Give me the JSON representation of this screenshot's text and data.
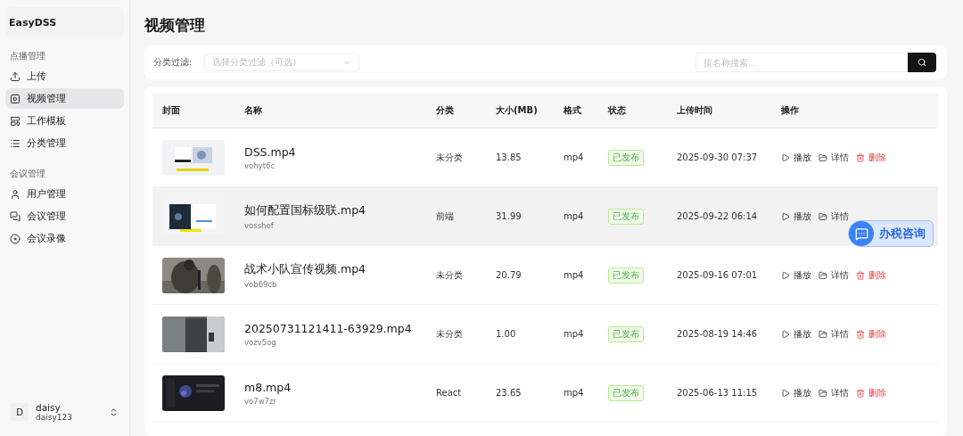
{
  "sidebar": {
    "brand": "EasyDSS",
    "groups": [
      {
        "title": "点播管理",
        "items": [
          {
            "label": "上传",
            "selected": false
          },
          {
            "label": "视频管理",
            "selected": true
          },
          {
            "label": "工作模板",
            "selected": false
          },
          {
            "label": "分类管理",
            "selected": false
          }
        ]
      },
      {
        "title": "会议管理",
        "items": [
          {
            "label": "用户管理",
            "selected": false
          },
          {
            "label": "会议管理",
            "selected": false
          },
          {
            "label": "会议录像",
            "selected": false
          }
        ]
      }
    ],
    "user": {
      "avatar": "D",
      "name": "daisy",
      "account": "daisy123"
    }
  },
  "page_title": "视频管理",
  "filter": {
    "label": "分类过滤:",
    "placeholder": "选择分类过滤（可选)"
  },
  "search": {
    "placeholder": "按名称搜索..."
  },
  "table": {
    "columns": [
      "封面",
      "名称",
      "分类",
      "大小(MB)",
      "格式",
      "状态",
      "上传时间",
      "操作"
    ],
    "rows": [
      {
        "cover": {
          "kind": "picture"
        },
        "name": "DSS.mp4",
        "id": "vohyt6c",
        "category": "未分类",
        "size": "13.85",
        "format": "mp4",
        "status": "已发布",
        "time": "2025-09-30 07:37",
        "hovered": false,
        "actions": [
          {
            "kind": "play",
            "label": "播放"
          },
          {
            "kind": "detail",
            "label": "详情"
          },
          {
            "kind": "delete",
            "label": "删除"
          }
        ]
      },
      {
        "cover": {
          "kind": "picture"
        },
        "name": "如何配置国标级联.mp4",
        "id": "vosshef",
        "category": "前端",
        "size": "31.99",
        "format": "mp4",
        "status": "已发布",
        "time": "2025-09-22 06:14",
        "hovered": true,
        "actions": [
          {
            "kind": "play",
            "label": "播放"
          },
          {
            "kind": "detail",
            "label": "详情"
          }
        ]
      },
      {
        "cover": {
          "kind": "picture"
        },
        "name": "战术小队宣传视频.mp4",
        "id": "vob69cb",
        "category": "未分类",
        "size": "20.79",
        "format": "mp4",
        "status": "已发布",
        "time": "2025-09-16 07:01",
        "hovered": false,
        "actions": [
          {
            "kind": "play",
            "label": "播放"
          },
          {
            "kind": "detail",
            "label": "详情"
          },
          {
            "kind": "delete",
            "label": "删除"
          }
        ]
      },
      {
        "cover": {
          "kind": "picture"
        },
        "name": "20250731121411-63929.mp4",
        "id": "vozv5og",
        "category": "未分类",
        "size": "1.00",
        "format": "mp4",
        "status": "已发布",
        "time": "2025-08-19 14:46",
        "hovered": false,
        "actions": [
          {
            "kind": "play",
            "label": "播放"
          },
          {
            "kind": "detail",
            "label": "详情"
          },
          {
            "kind": "delete",
            "label": "删除"
          }
        ]
      },
      {
        "cover": {
          "kind": "picture"
        },
        "name": "m8.mp4",
        "id": "vo7w7zr",
        "category": "React",
        "size": "23.65",
        "format": "mp4",
        "status": "已发布",
        "time": "2025-06-13 11:15",
        "hovered": false,
        "actions": [
          {
            "kind": "play",
            "label": "播放"
          },
          {
            "kind": "detail",
            "label": "详情"
          },
          {
            "kind": "delete",
            "label": "删除"
          }
        ]
      }
    ]
  },
  "float_button": {
    "label": "办税咨询"
  }
}
